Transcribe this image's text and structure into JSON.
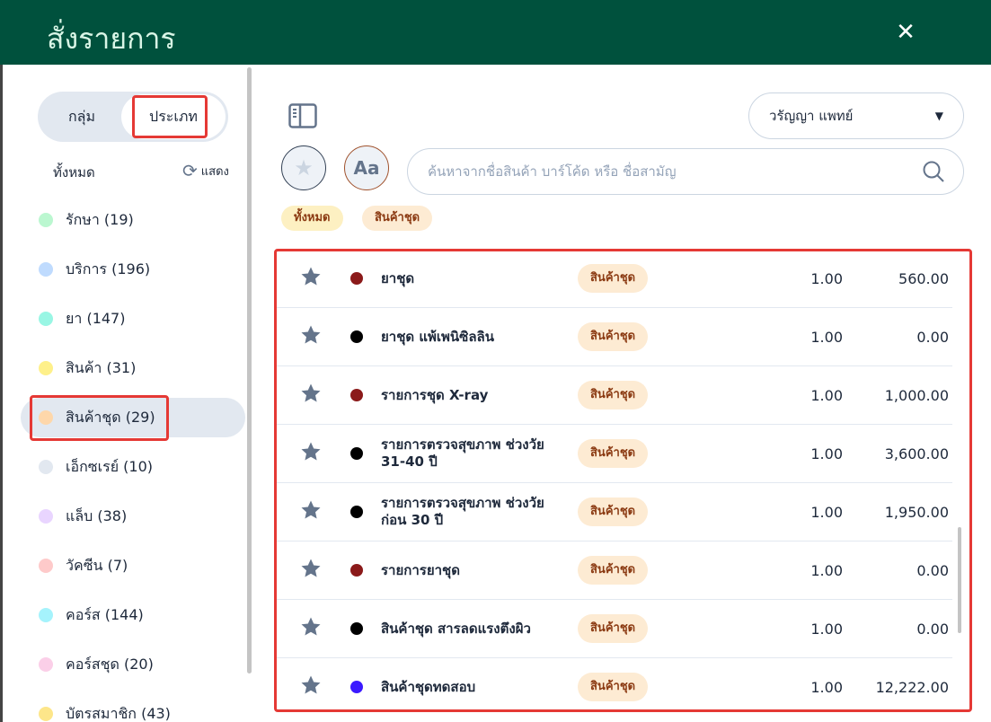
{
  "header": {
    "title": "สั่งรายการ",
    "close_icon": "close-icon"
  },
  "sidebar": {
    "toggle": {
      "group": "กลุ่ม",
      "type": "ประเภท",
      "selected": "ประเภท"
    },
    "all_label": "ทั้งหมด",
    "show_label": "แสดง",
    "categories": [
      {
        "label": "รักษา (19)",
        "color": "#bbf7d0"
      },
      {
        "label": "บริการ (196)",
        "color": "#bfdbfe"
      },
      {
        "label": "ยา (147)",
        "color": "#99f6e4"
      },
      {
        "label": "สินค้า (31)",
        "color": "#fef08a"
      },
      {
        "label": "สินค้าชุด (29)",
        "color": "#fed7aa",
        "selected": true
      },
      {
        "label": "เอ็กซเรย์ (10)",
        "color": "#e2e8f0"
      },
      {
        "label": "แล็บ (38)",
        "color": "#e9d5ff"
      },
      {
        "label": "วัคซีน (7)",
        "color": "#fecaca"
      },
      {
        "label": "คอร์ส (144)",
        "color": "#a5f3fc"
      },
      {
        "label": "คอร์สชุด (20)",
        "color": "#fbcfe8"
      },
      {
        "label": "บัตรสมาชิก (43)",
        "color": "#fde68a"
      }
    ]
  },
  "main": {
    "doctor_select": "วรัญญา แพทย์",
    "font_button": "Aa",
    "search_placeholder": "ค้นหาจากชื่อสินค้า บาร์โค้ด  หรือ ชื่อสามัญ",
    "chips": [
      {
        "label": "ทั้งหมด",
        "color": "#fdf0c2"
      },
      {
        "label": "สินค้าชุด",
        "color": "#fdebd3"
      }
    ],
    "items": [
      {
        "name": "ยาชุด",
        "dot": "#8b1a1a",
        "badge": "สินค้าชุด",
        "qty": "1.00",
        "price": "560.00"
      },
      {
        "name": "ยาชุด แพ้เพนิซิลลิน",
        "dot": "#000000",
        "badge": "สินค้าชุด",
        "qty": "1.00",
        "price": "0.00"
      },
      {
        "name": "รายการชุด X-ray",
        "dot": "#8b1a1a",
        "badge": "สินค้าชุด",
        "qty": "1.00",
        "price": "1,000.00"
      },
      {
        "name": "รายการตรวจสุขภาพ ช่วงวัย 31-40 ปี",
        "dot": "#000000",
        "badge": "สินค้าชุด",
        "qty": "1.00",
        "price": "3,600.00"
      },
      {
        "name": "รายการตรวจสุขภาพ ช่วงวัยก่อน 30 ปี",
        "dot": "#000000",
        "badge": "สินค้าชุด",
        "qty": "1.00",
        "price": "1,950.00"
      },
      {
        "name": "รายการยาชุด",
        "dot": "#8b1a1a",
        "badge": "สินค้าชุด",
        "qty": "1.00",
        "price": "0.00"
      },
      {
        "name": "สินค้าชุด สารลดแรงตึงผิว",
        "dot": "#000000",
        "badge": "สินค้าชุด",
        "qty": "1.00",
        "price": "0.00"
      },
      {
        "name": "สินค้าชุดทดสอบ",
        "dot": "#3b1aff",
        "badge": "สินค้าชุด",
        "qty": "1.00",
        "price": "12,222.00"
      }
    ]
  }
}
